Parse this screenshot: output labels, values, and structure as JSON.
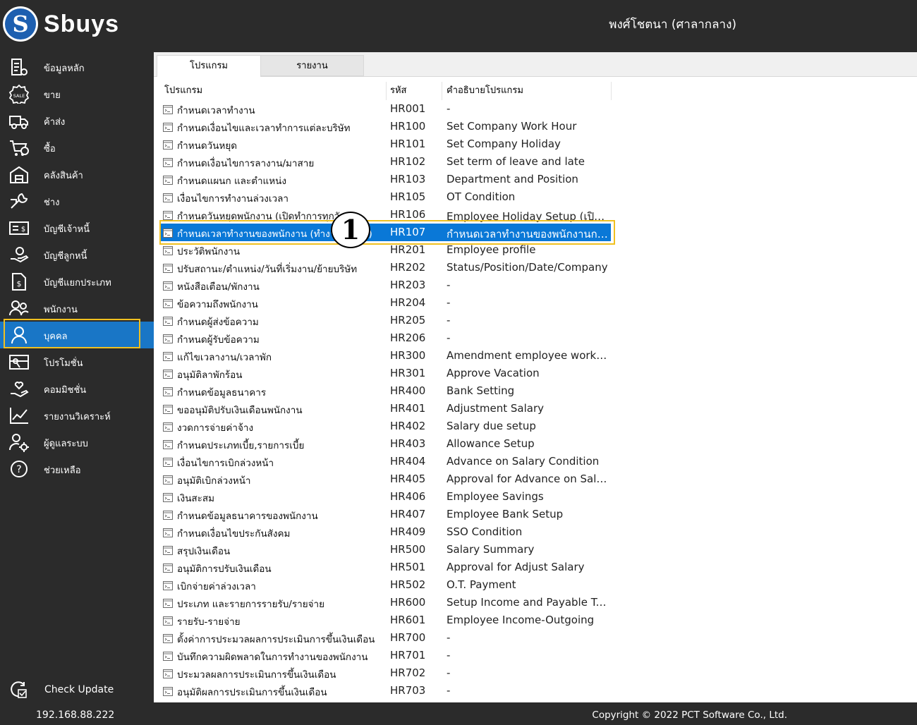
{
  "app": {
    "logo_text": "Sbuys",
    "logo_letter": "S",
    "user": "พงศ์โชตนา (ศาลากลาง)"
  },
  "sidebar": {
    "items": [
      {
        "label": "ข้อมูลหลัก",
        "icon": "master-data-icon"
      },
      {
        "label": "ขาย",
        "icon": "sale-badge-icon"
      },
      {
        "label": "ค้าส่ง",
        "icon": "truck-icon"
      },
      {
        "label": "ซื้อ",
        "icon": "cart-icon"
      },
      {
        "label": "คลังสินค้า",
        "icon": "warehouse-icon"
      },
      {
        "label": "ช่าง",
        "icon": "wrench-icon"
      },
      {
        "label": "บัญชีเจ้าหนี้",
        "icon": "payable-card-icon"
      },
      {
        "label": "บัญชีลูกหนี้",
        "icon": "receivable-hand-icon"
      },
      {
        "label": "บัญชีแยกประเภท",
        "icon": "ledger-icon"
      },
      {
        "label": "พนักงาน",
        "icon": "employees-icon"
      },
      {
        "label": "บุคคล",
        "icon": "person-icon"
      },
      {
        "label": "โปรโมชั่น",
        "icon": "promotion-icon"
      },
      {
        "label": "คอมมิชชั่น",
        "icon": "commission-icon"
      },
      {
        "label": "รายงานวิเคราะห์",
        "icon": "analysis-chart-icon"
      },
      {
        "label": "ผู้ดูแลระบบ",
        "icon": "admin-gear-icon"
      },
      {
        "label": "ช่วยเหลือ",
        "icon": "help-icon"
      }
    ],
    "active_index": 10,
    "check_update": "Check Update",
    "ip": "192.168.88.222"
  },
  "tabs": [
    {
      "label": "โปรแกรม"
    },
    {
      "label": "รายงาน"
    }
  ],
  "columns": {
    "program": "โปรแกรม",
    "code": "รหัส",
    "description": "คำอธิบายโปรแกรม"
  },
  "rows": [
    {
      "name": "กำหนดเวลาทำงาน",
      "code": "HR001",
      "desc": "-"
    },
    {
      "name": "กำหนดเงื่อนไขและเวลาทำการแต่ละบริษัท",
      "code": "HR100",
      "desc": "Set Company Work Hour"
    },
    {
      "name": "กำหนดวันหยุด",
      "code": "HR101",
      "desc": "Set Company Holiday"
    },
    {
      "name": "กำหนดเงื่อนไขการลางาน/มาสาย",
      "code": "HR102",
      "desc": "Set term of leave and late"
    },
    {
      "name": "กำหนดแผนก และตำแหน่ง",
      "code": "HR103",
      "desc": "Department and Position"
    },
    {
      "name": "เงื่อนไขการทำงานล่วงเวลา",
      "code": "HR105",
      "desc": "OT Condition"
    },
    {
      "name": "กำหนดวันหยุดพนักงาน (เปิดทำการทุกวัน)",
      "code": "HR106",
      "desc": "Employee Holiday Setup (เปิดทำการทุกวัน)"
    },
    {
      "name": "กำหนดเวลาทำงานของพนักงาน (ทำงานเป็นกะ)",
      "code": "HR107",
      "desc": "กำหนดเวลาทำงานของพนักงานกรณีทำงานเป็นกะ"
    },
    {
      "name": "ประวัติพนักงาน",
      "code": "HR201",
      "desc": "Employee profile"
    },
    {
      "name": "ปรับสถานะ/ตำแหน่ง/วันที่เริ่มงาน/ย้ายบริษัท",
      "code": "HR202",
      "desc": "Status/Position/Date/Company"
    },
    {
      "name": "หนังสือเตือน/พักงาน",
      "code": "HR203",
      "desc": "-"
    },
    {
      "name": "ข้อความถึงพนักงาน",
      "code": "HR204",
      "desc": "-"
    },
    {
      "name": "กำหนดผู้ส่งข้อความ",
      "code": "HR205",
      "desc": "-"
    },
    {
      "name": "กำหนดผู้รับข้อความ",
      "code": "HR206",
      "desc": "-"
    },
    {
      "name": "แก้ไขเวลางาน/เวลาพัก",
      "code": "HR300",
      "desc": "Amendment employee working"
    },
    {
      "name": "อนุมัติลาพักร้อน",
      "code": "HR301",
      "desc": "Approve Vacation"
    },
    {
      "name": "กำหนดข้อมูลธนาคาร",
      "code": "HR400",
      "desc": "Bank Setting"
    },
    {
      "name": "ขออนุมัติปรับเงินเดือนพนักงาน",
      "code": "HR401",
      "desc": "Adjustment Salary"
    },
    {
      "name": "งวดการจ่ายค่าจ้าง",
      "code": "HR402",
      "desc": "Salary due setup"
    },
    {
      "name": "กำหนดประเภทเบี้ย,รายการเบี้ย",
      "code": "HR403",
      "desc": "Allowance Setup"
    },
    {
      "name": "เงื่อนไขการเบิกล่วงหน้า",
      "code": "HR404",
      "desc": "Advance on Salary Condition"
    },
    {
      "name": "อนุมัติเบิกล่วงหน้า",
      "code": "HR405",
      "desc": "Approval for Advance on Salary"
    },
    {
      "name": "เงินสะสม",
      "code": "HR406",
      "desc": "Employee Savings"
    },
    {
      "name": "กำหนดข้อมูลธนาคารของพนักงาน",
      "code": "HR407",
      "desc": "Employee Bank Setup"
    },
    {
      "name": "กำหนดเงื่อนไขประกันสังคม",
      "code": "HR409",
      "desc": "SSO Condition"
    },
    {
      "name": "สรุปเงินเดือน",
      "code": "HR500",
      "desc": "Salary Summary"
    },
    {
      "name": "อนุมัติการปรับเงินเดือน",
      "code": "HR501",
      "desc": "Approval for Adjust Salary"
    },
    {
      "name": "เบิกจ่ายค่าล่วงเวลา",
      "code": "HR502",
      "desc": "O.T. Payment"
    },
    {
      "name": "ประเภท และรายการรายรับ/รายจ่าย",
      "code": "HR600",
      "desc": "Setup Income and Payable Type"
    },
    {
      "name": "รายรับ-รายจ่าย",
      "code": "HR601",
      "desc": "Employee Income-Outgoing"
    },
    {
      "name": "ตั้งค่าการประมวลผลการประเมินการขึ้นเงินเดือน",
      "code": "HR700",
      "desc": "-"
    },
    {
      "name": "บันทึกความผิดพลาดในการทำงานของพนักงาน",
      "code": "HR701",
      "desc": "-"
    },
    {
      "name": "ประมวลผลการประเมินการขึ้นเงินเดือน",
      "code": "HR702",
      "desc": "-"
    },
    {
      "name": "อนุมัติผลการประเมินการขึ้นเงินเดือน",
      "code": "HR703",
      "desc": "-"
    }
  ],
  "selected_row": 7,
  "callout": "1",
  "footer": {
    "copyright": "Copyright © 2022 PCT Software Co., Ltd."
  },
  "colors": {
    "accent": "#1976c6",
    "selection": "#0a78d7",
    "highlight": "#f0c020",
    "chrome": "#2b2b2b"
  }
}
